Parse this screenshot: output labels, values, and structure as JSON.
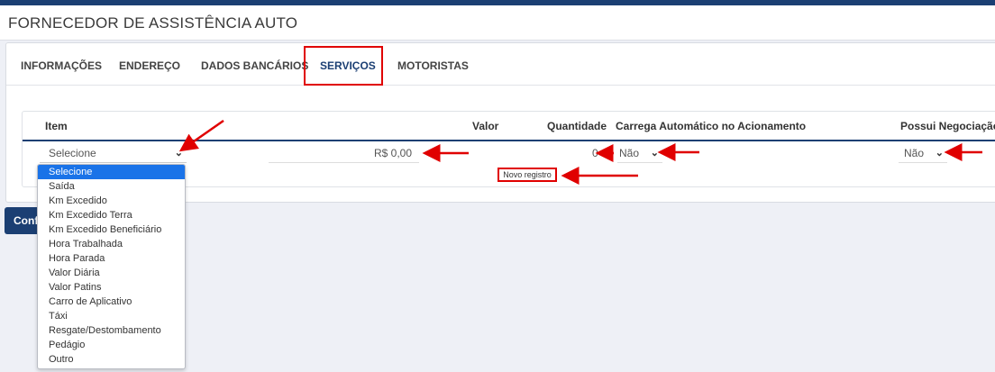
{
  "page": {
    "title": "FORNECEDOR DE ASSISTÊNCIA AUTO"
  },
  "tabs": [
    {
      "label": "INFORMAÇÕES"
    },
    {
      "label": "ENDEREÇO"
    },
    {
      "label": "DADOS BANCÁRIOS"
    },
    {
      "label": "SERVIÇOS",
      "active": true
    },
    {
      "label": "MOTORISTAS"
    }
  ],
  "table": {
    "headers": {
      "item": "Item",
      "valor": "Valor",
      "quantidade": "Quantidade",
      "carrega": "Carrega Automático no Acionamento",
      "negociacao": "Possui Negociação"
    },
    "row": {
      "item": "Selecione",
      "valor": "R$ 0,00",
      "quantidade": "0",
      "carrega": "Não",
      "negociacao": "Não"
    },
    "new_record_label": "Novo registro"
  },
  "confirm_button": "Confi",
  "dropdown": {
    "options": [
      "Selecione",
      "Saída",
      "Km Excedido",
      "Km Excedido Terra",
      "Km Excedido Beneficiário",
      "Hora Trabalhada",
      "Hora Parada",
      "Valor Diária",
      "Valor Patins",
      "Carro de Aplicativo",
      "Táxi",
      "Resgate/Destombamento",
      "Pedágio",
      "Outro"
    ],
    "selected": "Selecione"
  },
  "colors": {
    "primary": "#1b3f73",
    "highlight": "#e00000",
    "selection": "#1a73e8"
  }
}
